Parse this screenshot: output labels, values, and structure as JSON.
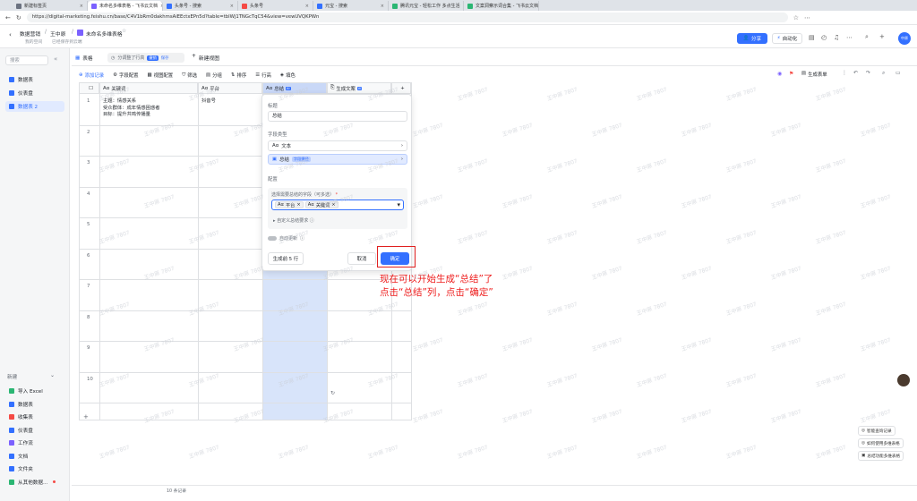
{
  "browser": {
    "tabs": [
      {
        "label": "新建标签页",
        "color": "#6b7280",
        "active": false
      },
      {
        "label": "未命名多维表格 - 飞书云文档",
        "color": "#7b61ff",
        "active": true
      },
      {
        "label": "头条号 - 搜索",
        "color": "#3370ff",
        "active": false
      },
      {
        "label": "头条号",
        "color": "#f54a45",
        "active": false
      },
      {
        "label": "元宝 - 搜索",
        "color": "#3370ff",
        "active": false
      },
      {
        "label": "腾讯元宝 - 轻松工作 多点生活",
        "color": "#2bb673",
        "active": false
      },
      {
        "label": "文案洞察示词合集 - 飞书云文档",
        "color": "#2bb673",
        "active": false
      }
    ],
    "url": "https://digital-marketing.feishu.cn/base/C4V1bRm0dakhmsAiEEctxEPn5d?table=tblWj1TNGcTqC54&view=vewUVQKPWn"
  },
  "header": {
    "breadcrumb_parent": "数据营销",
    "breadcrumb_owner": "王中原",
    "doc_title": "未命名多维表格",
    "subtitle_left": "我的空间",
    "subtitle_right": "已经保存到云端",
    "share_label": "分享",
    "auto_label": "自动化",
    "avatar_text": "中原"
  },
  "sidebar": {
    "search_placeholder": "搜索",
    "items": [
      {
        "label": "数据表",
        "color": "#3370ff"
      },
      {
        "label": "仪表盘",
        "color": "#3370ff"
      },
      {
        "label": "数据表 2",
        "color": "#3370ff"
      }
    ],
    "new_label": "新建",
    "new_items": [
      {
        "label": "导入 Excel",
        "color": "#2bb673"
      },
      {
        "label": "数据表",
        "color": "#3370ff"
      },
      {
        "label": "收集表",
        "color": "#f54a45"
      },
      {
        "label": "仪表盘",
        "color": "#3370ff"
      },
      {
        "label": "工作流",
        "color": "#7b61ff"
      },
      {
        "label": "文档",
        "color": "#3370ff"
      },
      {
        "label": "文件夹",
        "color": "#3370ff"
      },
      {
        "label": "从其他数据...",
        "color": "#2bb673"
      }
    ]
  },
  "viewtabs": {
    "table_label": "表格",
    "status_text": "分调整了行高",
    "status_badge1": "撤销",
    "status_badge2": "保存",
    "new_view": "新建视图"
  },
  "toolbar": {
    "add_record": "添加记录",
    "items": [
      "字段配置",
      "视图配置",
      "筛选",
      "分组",
      "排序",
      "行高",
      "填色"
    ],
    "generate": "生成表单"
  },
  "table": {
    "columns": [
      "关键词",
      "平台",
      "总结",
      "生成文案"
    ],
    "rows": [
      "1",
      "2",
      "3",
      "4",
      "5",
      "6",
      "7",
      "8",
      "9",
      "10"
    ],
    "row1_keyword": [
      "主题：情感关系",
      "受众群体：成年情感困惑者",
      "目标：提升共鸣传播量"
    ],
    "row1_platform": "抖音号",
    "footer": "10 条记录"
  },
  "panel": {
    "title_label": "标题",
    "title_value": "总结",
    "type_label": "字段类型",
    "type_text": "文本",
    "type_selected": "总结",
    "type_badge": "字段捷径",
    "config_label": "配置",
    "select_label": "选择需要总结的字段（可多选）",
    "required_mark": "*",
    "chips": [
      "平台",
      "关键词"
    ],
    "custom_label": "自定义总结要求",
    "auto_update": "自动更新",
    "generate_btn": "生成前 5 行",
    "cancel_btn": "取消",
    "confirm_btn": "确定"
  },
  "annotation": {
    "line1": "现在可以开始生成“总结”了",
    "line2": "点击“总结”列，点击“确定”"
  },
  "right_buttons": [
    "智能查询记录",
    "如何使用多维表格",
    "总结功能多维表格"
  ],
  "watermark": "王中原 7807"
}
